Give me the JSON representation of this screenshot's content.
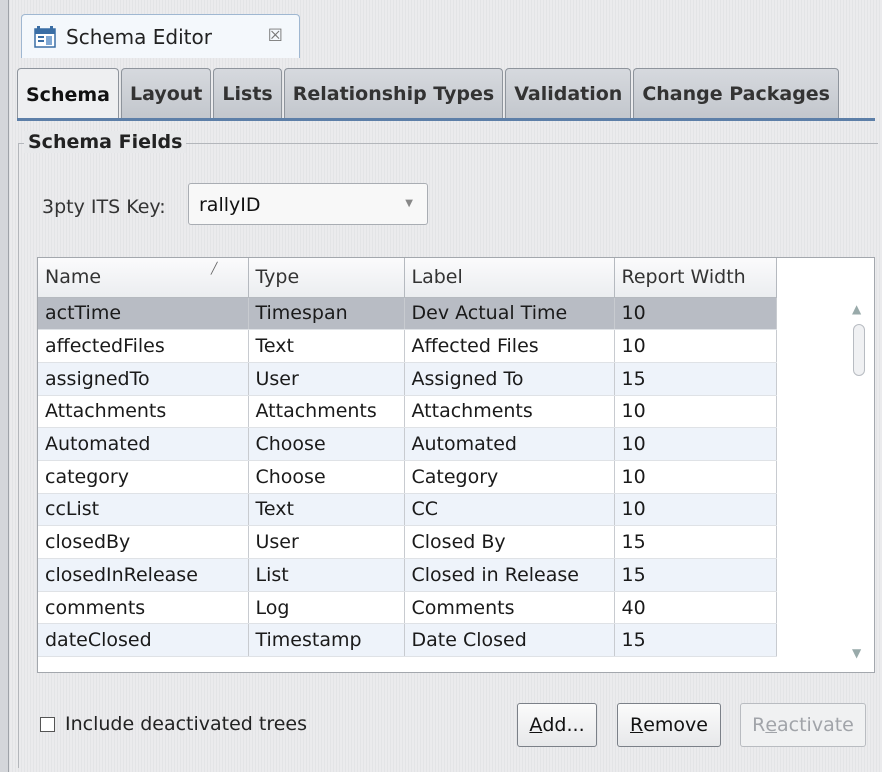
{
  "editor": {
    "tab_title": "Schema Editor",
    "close_glyph": "☒",
    "icon": "schema-editor-icon"
  },
  "subtabs": [
    {
      "label": "Schema",
      "active": true
    },
    {
      "label": "Layout",
      "active": false
    },
    {
      "label": "Lists",
      "active": false
    },
    {
      "label": "Relationship Types",
      "active": false
    },
    {
      "label": "Validation",
      "active": false
    },
    {
      "label": "Change Packages",
      "active": false
    }
  ],
  "group_title": "Schema Fields",
  "its_key": {
    "label": "3pty ITS Key:",
    "value": "rallyID"
  },
  "table": {
    "columns": [
      "Name",
      "Type",
      "Label",
      "Report Width"
    ],
    "rows": [
      [
        "actTime",
        "Timespan",
        "Dev Actual Time",
        "10"
      ],
      [
        "affectedFiles",
        "Text",
        "Affected Files",
        "10"
      ],
      [
        "assignedTo",
        "User",
        "Assigned To",
        "15"
      ],
      [
        "Attachments",
        "Attachments",
        "Attachments",
        "10"
      ],
      [
        "Automated",
        "Choose",
        "Automated",
        "10"
      ],
      [
        "category",
        "Choose",
        "Category",
        "10"
      ],
      [
        "ccList",
        "Text",
        "CC",
        "10"
      ],
      [
        "closedBy",
        "User",
        "Closed By",
        "15"
      ],
      [
        "closedInRelease",
        "List",
        "Closed in Release",
        "15"
      ],
      [
        "comments",
        "Log",
        "Comments",
        "40"
      ],
      [
        "dateClosed",
        "Timestamp",
        "Date Closed",
        "15"
      ]
    ],
    "selected_row": 0
  },
  "include_deactivated": {
    "label": "Include deactivated trees",
    "checked": false
  },
  "buttons": {
    "add": {
      "mnemonic": "A",
      "rest": "dd..."
    },
    "remove": {
      "mnemonic": "R",
      "rest": "emove"
    },
    "reactivate": {
      "pre": "R",
      "mnemonic": "e",
      "rest": "activate"
    }
  }
}
